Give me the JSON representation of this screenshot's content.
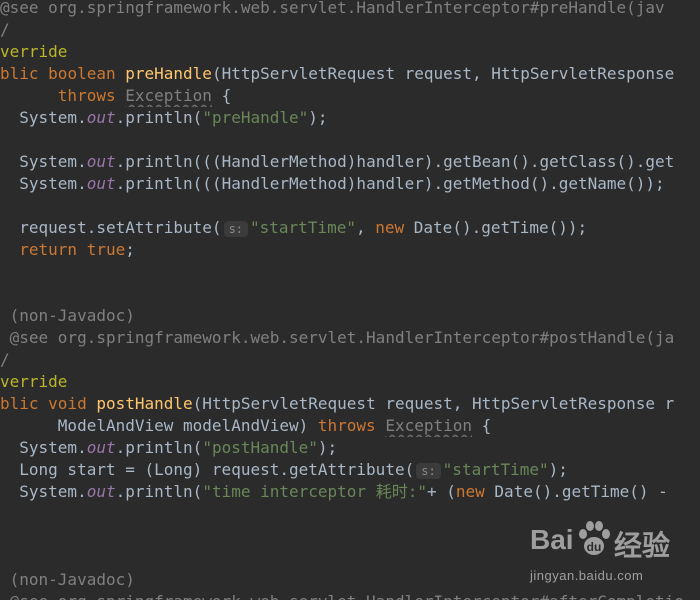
{
  "code_lines": [
    {
      "segments": [
        {
          "t": "@see org.springframework.web.servlet.HandlerInterceptor#preHandle(jav",
          "c": "comment"
        }
      ]
    },
    {
      "segments": [
        {
          "t": "/",
          "c": "comment"
        }
      ]
    },
    {
      "segments": [
        {
          "t": "verride",
          "c": "ann"
        }
      ]
    },
    {
      "segments": [
        {
          "t": "blic ",
          "c": "kw"
        },
        {
          "t": "boolean ",
          "c": "kw"
        },
        {
          "t": "preHandle",
          "c": "fn"
        },
        {
          "t": "(HttpServletRequest request, HttpServletResponse",
          "c": "plain"
        }
      ]
    },
    {
      "segments": [
        {
          "t": "      ",
          "c": "plain"
        },
        {
          "t": "throws ",
          "c": "kw"
        },
        {
          "t": "Exception",
          "c": "exc"
        },
        {
          "t": " {",
          "c": "plain"
        }
      ]
    },
    {
      "segments": [
        {
          "t": "  System.",
          "c": "plain"
        },
        {
          "t": "out",
          "c": "fld"
        },
        {
          "t": ".println(",
          "c": "plain"
        },
        {
          "t": "\"preHandle\"",
          "c": "str"
        },
        {
          "t": ");",
          "c": "plain"
        }
      ]
    },
    {
      "segments": []
    },
    {
      "segments": [
        {
          "t": "  System.",
          "c": "plain"
        },
        {
          "t": "out",
          "c": "fld"
        },
        {
          "t": ".println(((HandlerMethod)handler).getBean().getClass().get",
          "c": "plain"
        }
      ]
    },
    {
      "segments": [
        {
          "t": "  System.",
          "c": "plain"
        },
        {
          "t": "out",
          "c": "fld"
        },
        {
          "t": ".println(((HandlerMethod)handler).getMethod().getName());",
          "c": "plain"
        }
      ]
    },
    {
      "segments": []
    },
    {
      "segments": [
        {
          "t": "  request.setAttribute(",
          "c": "plain"
        },
        {
          "t": "s:",
          "c": "hint"
        },
        {
          "t": "\"startTime\"",
          "c": "str"
        },
        {
          "t": ", ",
          "c": "plain"
        },
        {
          "t": "new ",
          "c": "kw"
        },
        {
          "t": "Date().getTime());",
          "c": "plain"
        }
      ]
    },
    {
      "segments": [
        {
          "t": "  ",
          "c": "plain"
        },
        {
          "t": "return true",
          "c": "kw"
        },
        {
          "t": ";",
          "c": "plain"
        }
      ]
    },
    {
      "segments": []
    },
    {
      "segments": []
    },
    {
      "segments": [
        {
          "t": " (non-Javadoc)",
          "c": "comment"
        }
      ]
    },
    {
      "segments": [
        {
          "t": " @see org.springframework.web.servlet.HandlerInterceptor#postHandle(ja",
          "c": "comment"
        }
      ]
    },
    {
      "segments": [
        {
          "t": "/",
          "c": "comment"
        }
      ]
    },
    {
      "segments": [
        {
          "t": "verride",
          "c": "ann"
        }
      ]
    },
    {
      "segments": [
        {
          "t": "blic ",
          "c": "kw"
        },
        {
          "t": "void ",
          "c": "kw"
        },
        {
          "t": "postHandle",
          "c": "fn"
        },
        {
          "t": "(HttpServletRequest request, HttpServletResponse r",
          "c": "plain"
        }
      ]
    },
    {
      "segments": [
        {
          "t": "      ModelAndView modelAndView) ",
          "c": "plain"
        },
        {
          "t": "throws ",
          "c": "kw"
        },
        {
          "t": "Exception",
          "c": "exc"
        },
        {
          "t": " {",
          "c": "plain"
        }
      ]
    },
    {
      "segments": [
        {
          "t": "  System.",
          "c": "plain"
        },
        {
          "t": "out",
          "c": "fld"
        },
        {
          "t": ".println(",
          "c": "plain"
        },
        {
          "t": "\"postHandle\"",
          "c": "str"
        },
        {
          "t": ");",
          "c": "plain"
        }
      ]
    },
    {
      "segments": [
        {
          "t": "  Long start = (Long) request.getAttribute(",
          "c": "plain"
        },
        {
          "t": "s:",
          "c": "hint"
        },
        {
          "t": "\"startTime\"",
          "c": "str"
        },
        {
          "t": ");",
          "c": "plain"
        }
      ]
    },
    {
      "segments": [
        {
          "t": "  System.",
          "c": "plain"
        },
        {
          "t": "out",
          "c": "fld"
        },
        {
          "t": ".println(",
          "c": "plain"
        },
        {
          "t": "\"time interceptor 耗时:\"",
          "c": "str"
        },
        {
          "t": "+ (",
          "c": "plain"
        },
        {
          "t": "new ",
          "c": "kw"
        },
        {
          "t": "Date().getTime() -",
          "c": "plain"
        }
      ]
    },
    {
      "segments": []
    },
    {
      "segments": []
    },
    {
      "segments": []
    },
    {
      "segments": [
        {
          "t": " (non-Javadoc)",
          "c": "comment"
        }
      ]
    },
    {
      "segments": [
        {
          "t": " @see org.springframework.web.servlet.HandlerInterceptor#afterCompletio",
          "c": "comment"
        }
      ]
    }
  ],
  "watermark": {
    "brand": "Bai",
    "brand_tail": "经验",
    "url": "jingyan.baidu.com"
  }
}
